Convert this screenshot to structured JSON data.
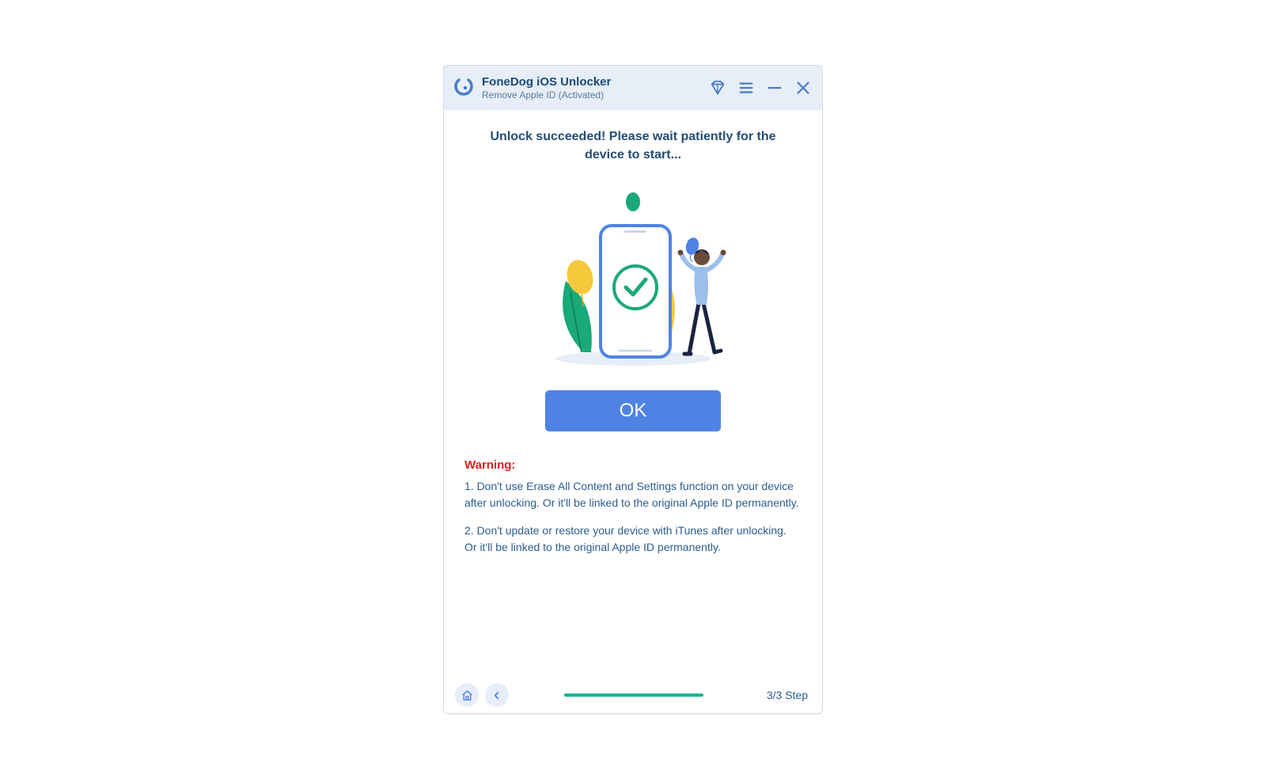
{
  "header": {
    "title": "FoneDog iOS Unlocker",
    "subtitle": "Remove Apple ID  (Activated)"
  },
  "main": {
    "headline": "Unlock succeeded! Please wait patiently for the device to start...",
    "ok_label": "OK"
  },
  "warning": {
    "title": "Warning:",
    "item1": "1. Don't use Erase All Content and Settings function on your device after unlocking. Or it'll be linked to the original Apple ID permanently.",
    "item2": "2. Don't update or restore your device with iTunes after unlocking. Or it'll be linked to the original Apple ID permanently."
  },
  "footer": {
    "step_label": "3/3 Step"
  }
}
